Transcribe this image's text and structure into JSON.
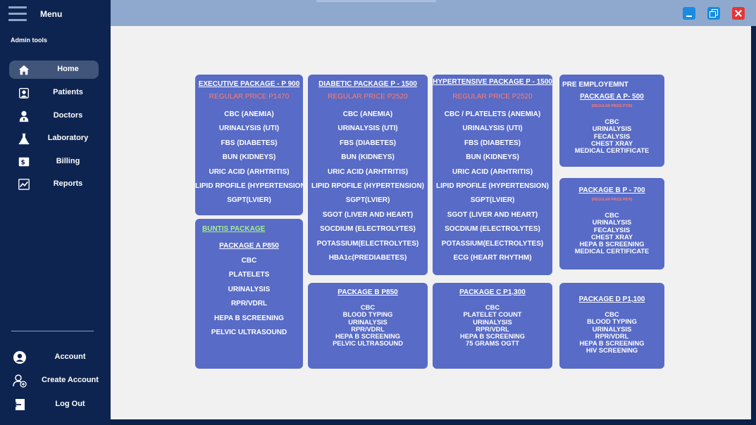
{
  "sidebar": {
    "menu_label": "Menu",
    "section_label": "Admin tools",
    "items": [
      {
        "label": "Home",
        "icon": "home-icon"
      },
      {
        "label": "Patients",
        "icon": "patients-icon"
      },
      {
        "label": "Doctors",
        "icon": "doctor-icon"
      },
      {
        "label": "Laboratory",
        "icon": "laboratory-icon"
      },
      {
        "label": "Billing",
        "icon": "billing-icon"
      },
      {
        "label": "Reports",
        "icon": "reports-icon"
      }
    ],
    "bottom_items": [
      {
        "label": "Account",
        "icon": "account-icon"
      },
      {
        "label": "Create Account",
        "icon": "add-user-icon"
      },
      {
        "label": "Log Out",
        "icon": "logout-icon"
      }
    ]
  },
  "colors": {
    "accent": "#586bc6",
    "sidebar": "#0e2450",
    "price": "#ff7d72",
    "highlight": "#a4f08c",
    "close": "#e53535",
    "window_button": "#1a8be0"
  },
  "packages": {
    "executive": {
      "title": "EXECUTIVE PACKAGE - P 900",
      "regular_price": "REGULAR PRICE P1470",
      "tests": [
        "CBC (ANEMIA)",
        "URINALYSIS (UTI)",
        "FBS (DIABETES)",
        "BUN (KIDNEYS)",
        "URIC ACID (ARHTRITIS)",
        "LIPID RPOFILE (HYPERTENSION",
        "SGPT(LVIER)"
      ]
    },
    "diabetic": {
      "title": "DIABETIC PACKAGE P - 1500",
      "regular_price": "REGULAR PRICE P2520",
      "tests": [
        "CBC (ANEMIA)",
        "URINALYSIS (UTI)",
        "FBS (DIABETES)",
        "BUN (KIDNEYS)",
        "URIC ACID (ARHTRITIS)",
        "LIPID RPOFILE (HYPERTENSION)",
        "SGPT(LVIER)",
        "SGOT (LIVER AND HEART)",
        "SOCDIUM (ELECTROLYTES)",
        "POTASSIUM(ELECTROLYTES)",
        "HBA1c(PREDIABETES)"
      ]
    },
    "hypertensive": {
      "title": "HYPERTENSIVE PACKAGE P - 1500",
      "regular_price": "REGULAR PRICE P2520",
      "tests": [
        "CBC / PLATELETS (ANEMIA)",
        "URINALYSIS (UTI)",
        "FBS (DIABETES)",
        "BUN (KIDNEYS)",
        "URIC ACID (ARHTRITIS)",
        "LIPID RPOFILE (HYPERTENSION)",
        "SGPT(LVIER)",
        "SGOT (LIVER AND HEART)",
        "SOCDIUM (ELECTROLYTES)",
        "POTASSIUM(ELECTROLYTES)",
        "ECG (HEART RHYTHM)"
      ]
    },
    "pre_employment": {
      "heading": "PRE EMPLOYEMNT",
      "package_a": {
        "title": "PACKAGE A P- 500",
        "regular_price": "(REGULAR PRICE P720)",
        "tests": [
          "CBC",
          "URINALYSIS",
          "FECALYSIS",
          "CHEST XRAY",
          "MEDICAL CERTIFICATE"
        ]
      },
      "package_b": {
        "title": "PACKAGE B P - 700",
        "regular_price": "(REGULAR PRICE P870)",
        "tests": [
          "CBC",
          "URINALYSIS",
          "FECALYSIS",
          "CHEST XRAY",
          "HEPA B SCREENING",
          "MEDICAL CERTIFICATE"
        ]
      }
    },
    "buntis": {
      "heading": "BUNTIS PACKAGE",
      "package_a": {
        "title": "PACKAGE A P850",
        "tests": [
          "CBC",
          "PLATELETS",
          "URINALYSIS",
          "RPR/VDRL",
          "HEPA B SCREENING",
          "PELVIC ULTRASOUND"
        ]
      },
      "package_b": {
        "title": "PACKAGE B P850",
        "tests": [
          "CBC",
          "BLOOD TYPING",
          "URINALYSIS",
          "RPR/VDRL",
          "HEPA B SCREENING",
          "PELVIC ULTRASOUND"
        ]
      },
      "package_c": {
        "title": "PACKAGE C P1,300",
        "tests": [
          "CBC",
          "PLATELET COUNT",
          "URINALYSIS",
          "RPR/VDRL",
          "HEPA B SCREENING",
          "75 GRAMS OGTT"
        ]
      },
      "package_d": {
        "title": "PACKAGE D P1,100",
        "tests": [
          "CBC",
          "BLOOD TYPING",
          "URINALYSIS",
          "RPR/VDRL",
          "HEPA B SCREENING",
          "HIV SCREENING"
        ]
      }
    }
  }
}
